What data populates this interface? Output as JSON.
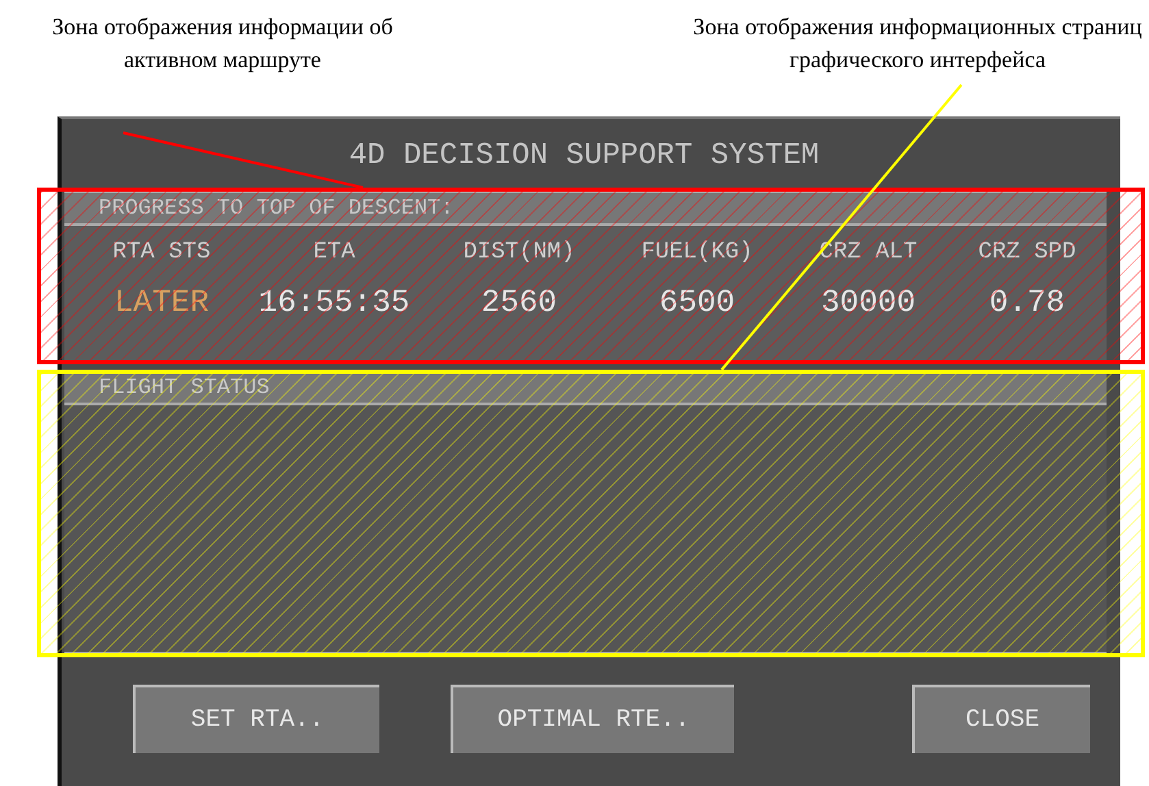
{
  "annotations": [
    {
      "label": "Зона отображения информации об активном маршруте",
      "color": "#ff0000"
    },
    {
      "label": "Зона отображения информационных страниц графического интерфейса",
      "color": "#ffff00"
    }
  ],
  "window": {
    "title": "4D DECISION SUPPORT SYSTEM"
  },
  "progress": {
    "title": "PROGRESS TO TOP OF DESCENT:",
    "columns": [
      {
        "label": "RTA STS",
        "value": "LATER",
        "color": "#d8a060"
      },
      {
        "label": "ETA",
        "value": "16:55:35",
        "color": "#e6e6e6"
      },
      {
        "label": "DIST(NM)",
        "value": "2560",
        "color": "#e6e6e6"
      },
      {
        "label": "FUEL(KG)",
        "value": "6500",
        "color": "#e6e6e6"
      },
      {
        "label": "CRZ ALT",
        "value": "30000",
        "color": "#e6e6e6"
      },
      {
        "label": "CRZ SPD",
        "value": "0.78",
        "color": "#e6e6e6"
      }
    ]
  },
  "flight_status": {
    "title": "FLIGHT STATUS"
  },
  "buttons": [
    "SET RTA..",
    "OPTIMAL RTE..",
    "CLOSE"
  ]
}
